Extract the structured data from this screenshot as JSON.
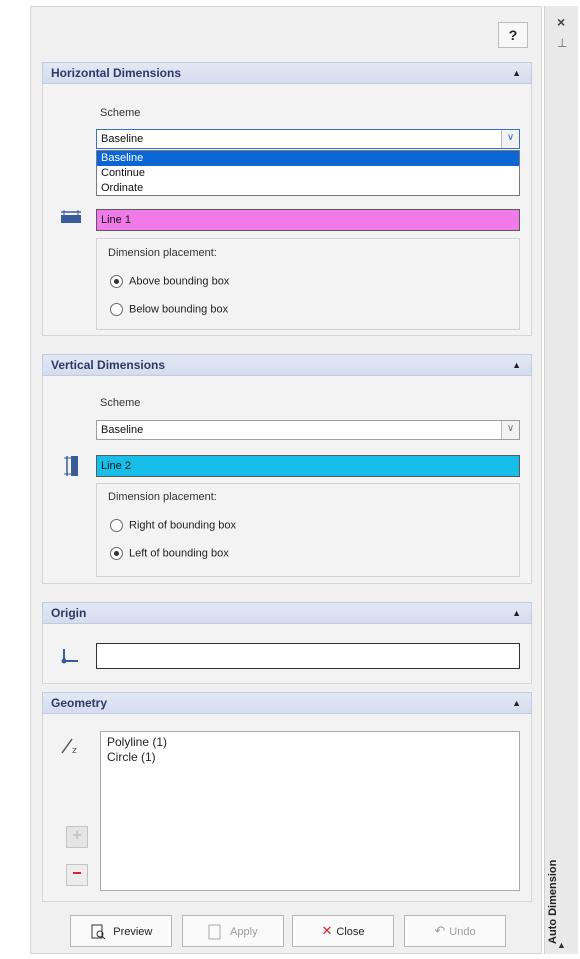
{
  "help_label": "?",
  "right_bar": {
    "title": "Auto Dimension",
    "close_glyph": "×",
    "pin_glyph": "⊥"
  },
  "horizontal": {
    "header": "Horizontal Dimensions",
    "scheme_label": "Scheme",
    "scheme_value": "Baseline",
    "options": [
      "Baseline",
      "Continue",
      "Ordinate"
    ],
    "line_value": "Line 1",
    "line_color": "#f07ae8",
    "placement_label": "Dimension placement:",
    "radio_above": "Above bounding box",
    "radio_below": "Below bounding box"
  },
  "vertical": {
    "header": "Vertical Dimensions",
    "scheme_label": "Scheme",
    "scheme_value": "Baseline",
    "line_value": "Line 2",
    "line_color": "#17bfe8",
    "placement_label": "Dimension placement:",
    "radio_right": "Right of bounding box",
    "radio_left": "Left of bounding box"
  },
  "origin": {
    "header": "Origin"
  },
  "geometry": {
    "header": "Geometry",
    "items": [
      "Polyline (1)",
      "Circle (1)"
    ]
  },
  "buttons": {
    "preview": "Preview",
    "apply": "Apply",
    "close": "Close",
    "undo": "Undo"
  }
}
